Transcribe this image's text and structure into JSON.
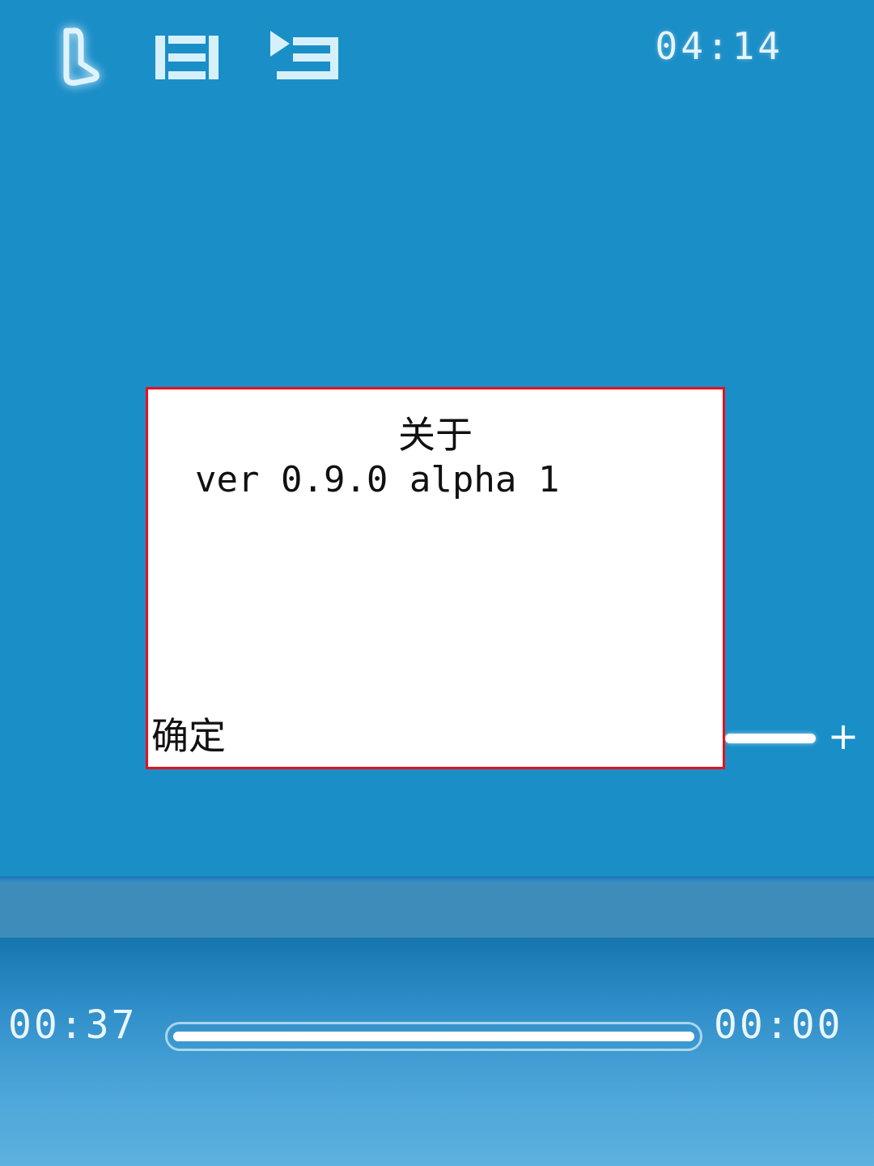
{
  "topbar": {
    "icons": [
      "music-note-icon",
      "list-icon",
      "playlist-icon"
    ],
    "clock": "04:14"
  },
  "dialog": {
    "title": "关于",
    "body": "ver 0.9.0 alpha 1",
    "ok_label": "确定"
  },
  "volume": {
    "plus_label": "+"
  },
  "player": {
    "elapsed": "00:37",
    "total": "00:00",
    "progress": 1.0
  },
  "colors": {
    "background": "#1a8ec7",
    "dialog_border": "#e8101c",
    "dialog_bg": "#ffffff"
  }
}
